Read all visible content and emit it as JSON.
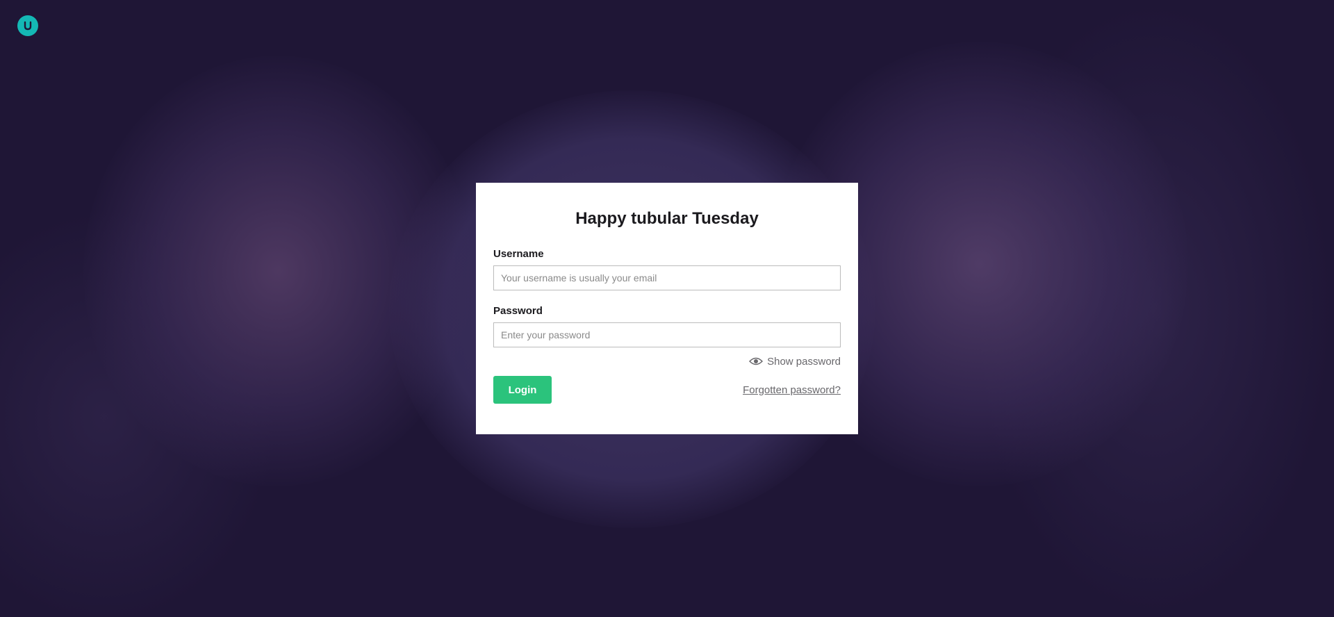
{
  "brand": {
    "logo_icon": "umbraco-logo-icon",
    "logo_color": "#14b8b5"
  },
  "login": {
    "title": "Happy tubular Tuesday",
    "username_label": "Username",
    "username_placeholder": "Your username is usually your email",
    "password_label": "Password",
    "password_placeholder": "Enter your password",
    "show_password_label": "Show password",
    "show_password_icon": "eye-icon",
    "login_button_label": "Login",
    "login_button_color": "#2bc37c",
    "forgot_password_label": "Forgotten password?"
  },
  "background": {
    "base_color": "#1f1636"
  }
}
